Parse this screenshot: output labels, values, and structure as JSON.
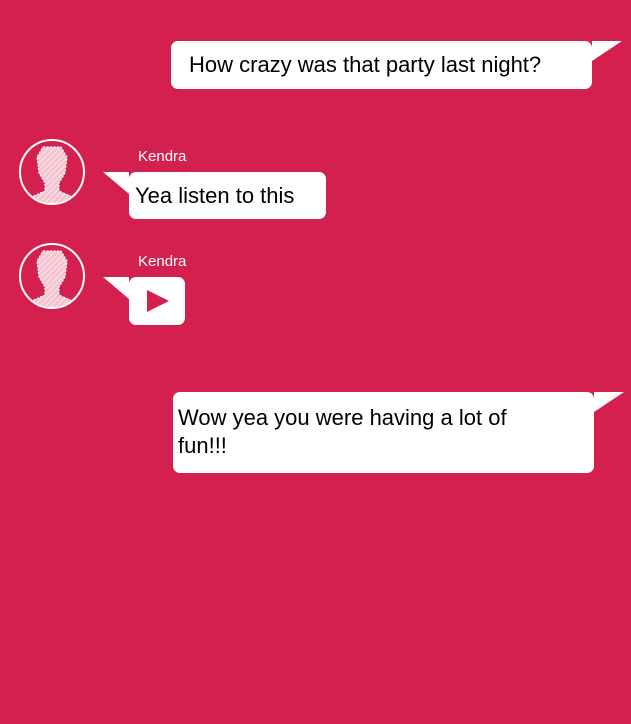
{
  "messages": [
    {
      "direction": "outgoing",
      "text": "How crazy was that party last night?"
    },
    {
      "direction": "incoming",
      "sender": "Kendra",
      "text": "Yea listen to this"
    },
    {
      "direction": "incoming",
      "sender": "Kendra",
      "type": "video",
      "icon": "play-icon"
    },
    {
      "direction": "outgoing",
      "text": "Wow yea you were having a lot of fun!!!"
    }
  ],
  "colors": {
    "background": "#d4204f",
    "bubble": "#ffffff"
  }
}
